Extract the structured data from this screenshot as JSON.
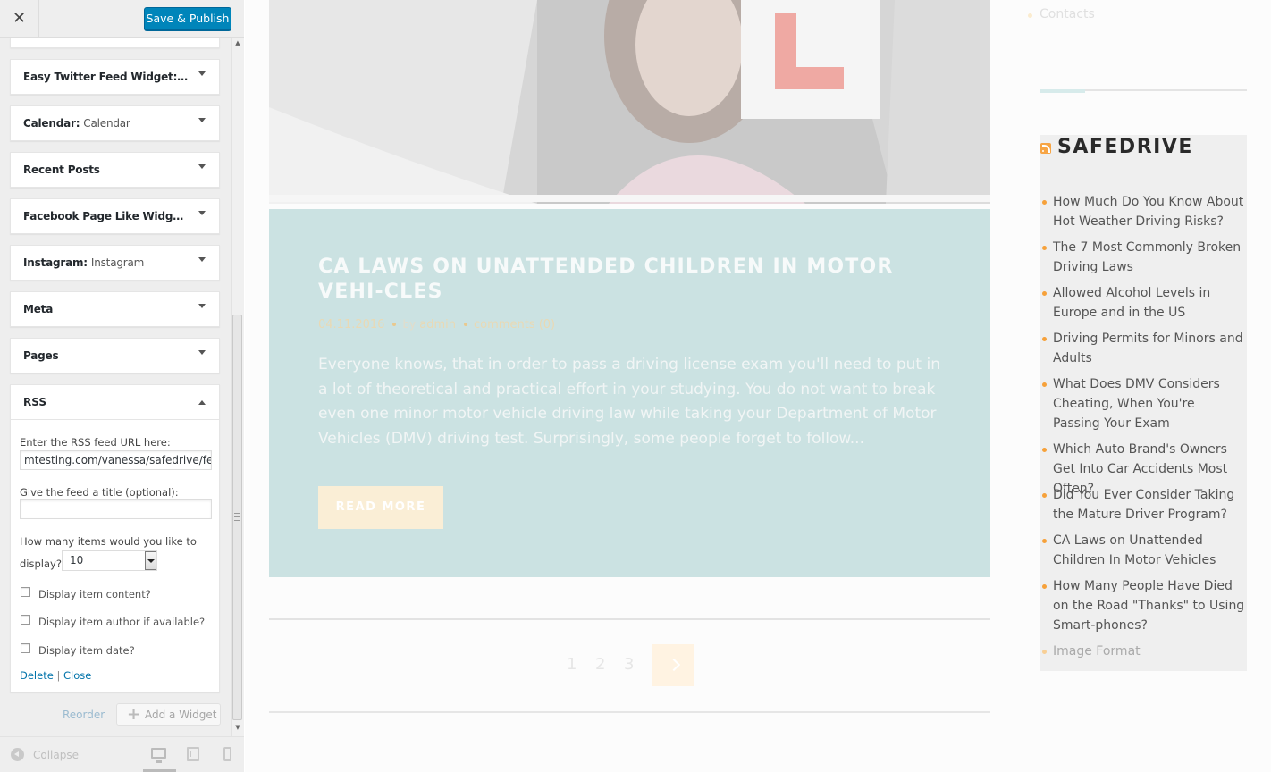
{
  "header": {
    "close_glyph": "✕",
    "save_label": "Save & Publish"
  },
  "widgets": [
    {
      "title": "Easy Twitter Feed Widget:",
      "subtitle": "T..."
    },
    {
      "title": "Calendar:",
      "subtitle": "Calendar"
    },
    {
      "title": "Recent Posts",
      "subtitle": ""
    },
    {
      "title": "Facebook Page Like Widget: ...",
      "subtitle": ""
    },
    {
      "title": "Instagram:",
      "subtitle": "Instagram"
    },
    {
      "title": "Meta",
      "subtitle": ""
    },
    {
      "title": "Pages",
      "subtitle": ""
    }
  ],
  "rss_form": {
    "title": "RSS",
    "url_label": "Enter the RSS feed URL here:",
    "url_value": "mtesting.com/vanessa/safedrive/feed",
    "feed_title_label": "Give the feed a title (optional):",
    "feed_title_value": "",
    "items_label_1": "How many items would you like to",
    "items_label_2": "display?",
    "items_value": "10",
    "check_content": "Display item content?",
    "check_author": "Display item author if available?",
    "check_date": "Display item date?",
    "delete_label": "Delete",
    "sep": "|",
    "close_label": "Close"
  },
  "footer_actions": {
    "reorder_label": "Reorder",
    "add_widget_label": "Add a Widget",
    "plus_glyph": "+"
  },
  "footer": {
    "collapse_label": "Collapse"
  },
  "post": {
    "title": "CA LAWS ON UNATTENDED CHILDREN IN MOTOR VEHI-CLES",
    "date": "04.11.2016",
    "by_label": "by",
    "author": "admin",
    "comments": "comments (0)",
    "excerpt": "Everyone knows, that in order to pass a driving license exam you'll need to put in a lot of theoretical and practical effort in your studying. You do not want to break even one minor motor vehicle driving law while taking your Department of Motor Vehicles (DMV) driving test. Surprisingly, some people forget to follow...",
    "read_more": "READ MORE"
  },
  "pagination": {
    "pages": [
      "1",
      "2",
      "3"
    ]
  },
  "right_sidebar": {
    "contacts": "Contacts",
    "rss_title": "SAFEDRIVE",
    "items": [
      "How Much Do You Know About Hot Weather Driving Risks?",
      "The 7 Most Commonly Broken Driving Laws",
      "Allowed Alcohol Levels in Europe and in the US",
      "Driving Permits for Minors and Adults",
      "What Does DMV Considers Cheating, When You're Passing Your Exam",
      "Which Auto Brand's Owners Get Into Car Accidents Most Often?",
      "Did You Ever Consider Taking the Mature Driver Program?",
      "CA Laws on Unattended Children In Motor Vehicles",
      "How Many People Have Died on the Road \"Thanks\" to Using Smart-phones?",
      "Image Format"
    ]
  },
  "colors": {
    "primary_button": "#0085ba",
    "post_card_bg": "#cbe2e2",
    "read_more_bg": "#faeed6",
    "bullet_accent": "#f6a13a"
  },
  "icons": [
    "close-icon",
    "chevron-down-icon",
    "chevron-up-icon",
    "plus-icon",
    "collapse-icon",
    "desktop-icon",
    "tablet-icon",
    "mobile-icon",
    "rss-icon",
    "next-arrow-icon"
  ]
}
